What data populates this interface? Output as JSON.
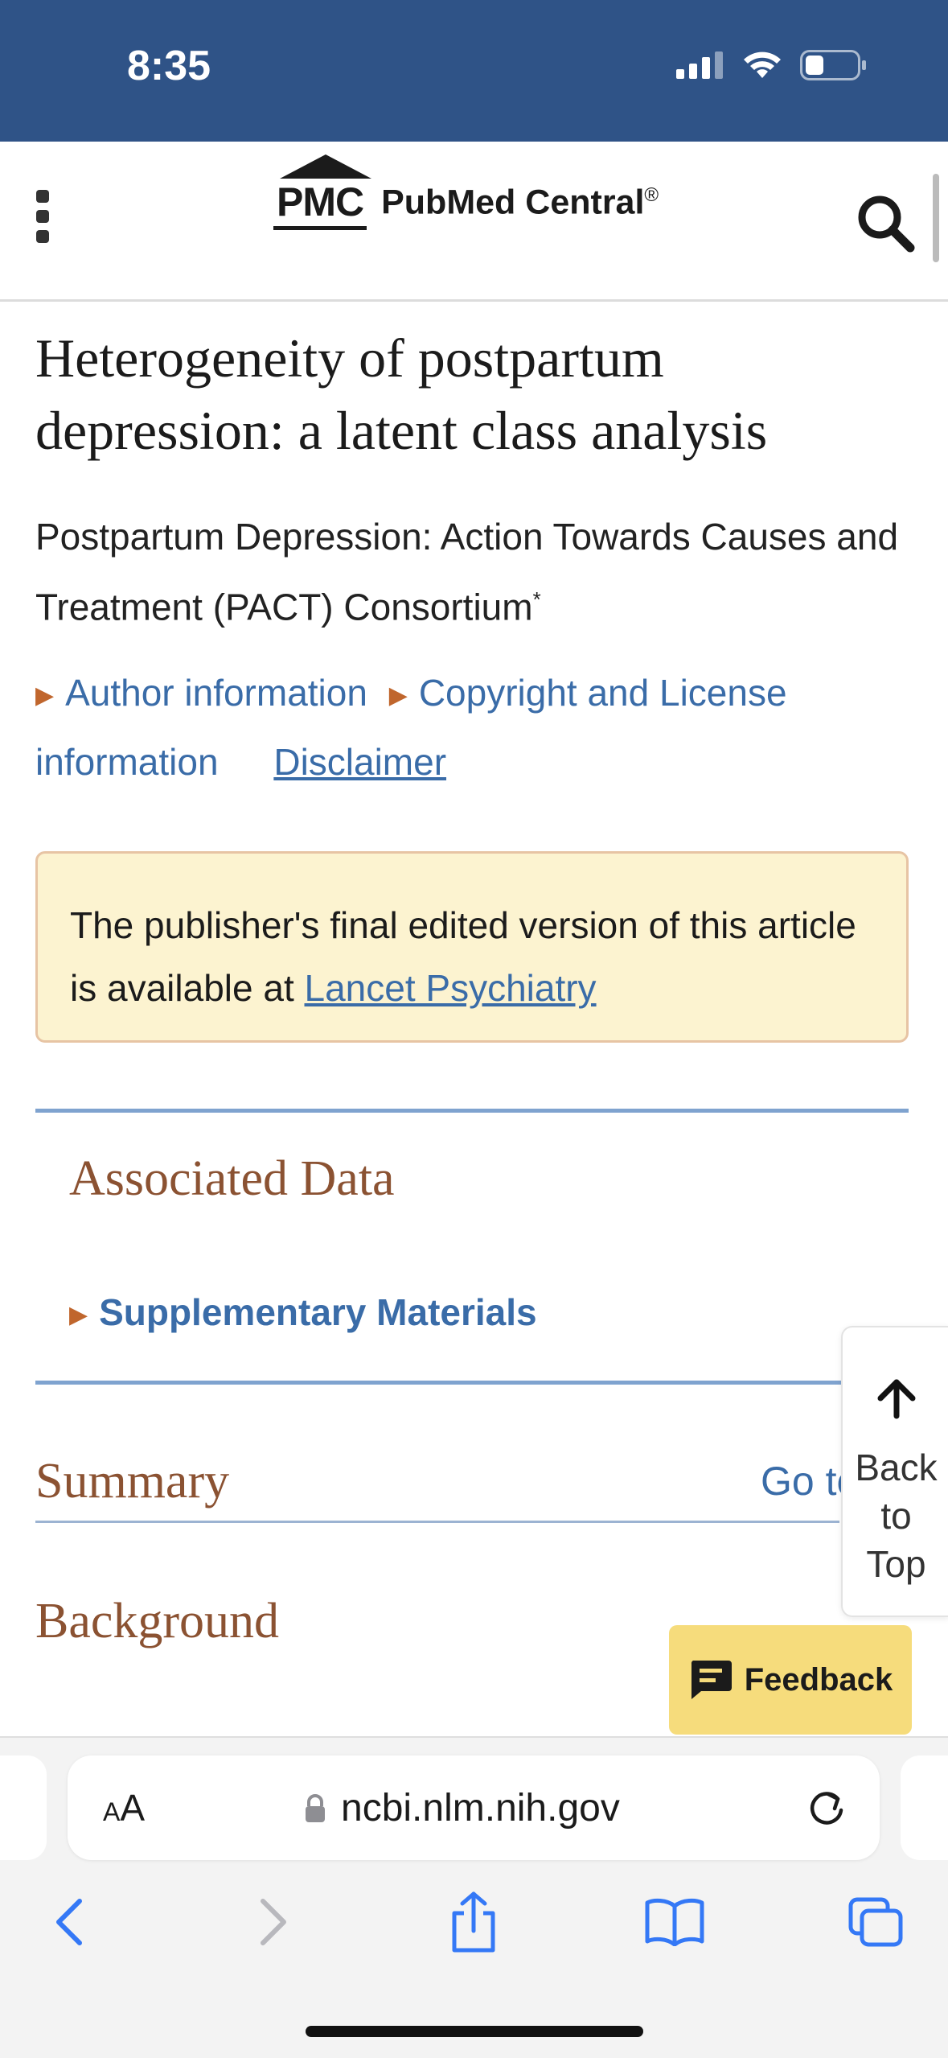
{
  "status_bar": {
    "time": "8:35"
  },
  "header": {
    "logo_abbr": "PMC",
    "logo_name": "PubMed Central",
    "logo_reg": "®"
  },
  "article": {
    "title": "Heterogeneity of postpartum depression: a latent class analysis",
    "authors": "Postpartum Depression: Action Towards Causes and Treatment (PACT) Consortium",
    "authors_mark": "*",
    "links": {
      "author_info": "Author information",
      "copyright": "Copyright and License information",
      "disclaimer": "Disclaimer"
    },
    "notice_text": "The publisher's final edited version of this article is available at",
    "notice_link": "Lancet Psychiatry",
    "associated_data_title": "Associated Data",
    "supplementary_label": "Supplementary Materials",
    "summary_title": "Summary",
    "goto_label": "Go to",
    "background_title": "Background"
  },
  "floating": {
    "back_to_top": [
      "Back",
      "to",
      "Top"
    ],
    "feedback_label": "Feedback"
  },
  "browser": {
    "text_size_label_small": "A",
    "text_size_label_large": "A",
    "url": "ncbi.nlm.nih.gov"
  },
  "colors": {
    "status_bar_bg": "#2f5387",
    "link": "#3a6ca8",
    "heading_brown": "#8b5232",
    "notice_bg": "#fcf3d0",
    "feedback_bg": "#f6dc7c"
  }
}
